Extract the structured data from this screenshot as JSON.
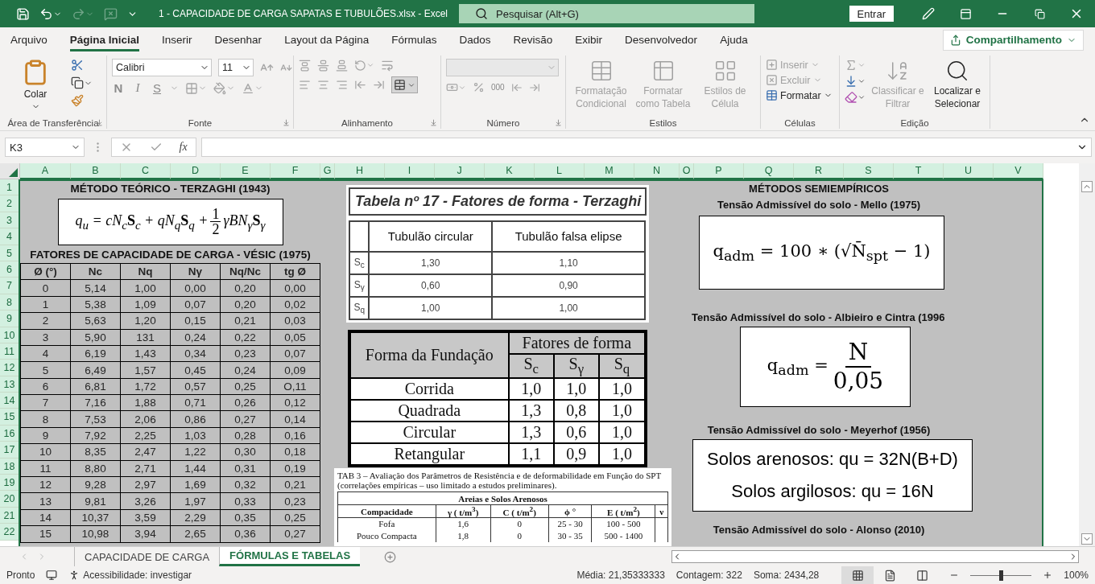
{
  "title_bar": {
    "title": "1 - CAPACIDADE DE CARGA SAPATAS E TUBULÕES.xlsx  -  Excel",
    "search": {
      "placeholder": "Pesquisar (Alt+G)"
    },
    "sign_in": "Entrar",
    "redo": {
      "disabled": true
    }
  },
  "menu": {
    "tabs": [
      {
        "label": "Arquivo",
        "selected": false
      },
      {
        "label": "Página Inicial",
        "selected": true
      },
      {
        "label": "Inserir",
        "selected": false
      },
      {
        "label": "Desenhar",
        "selected": false
      },
      {
        "label": "Layout da Página",
        "selected": false
      },
      {
        "label": "Fórmulas",
        "selected": false
      },
      {
        "label": "Dados",
        "selected": false
      },
      {
        "label": "Revisão",
        "selected": false
      },
      {
        "label": "Exibir",
        "selected": false
      },
      {
        "label": "Desenvolvedor",
        "selected": false
      },
      {
        "label": "Ajuda",
        "selected": false
      }
    ],
    "share": "Compartilhamento"
  },
  "ribbon": {
    "clipboard": {
      "paste": "Colar",
      "label": "Área de Transferência"
    },
    "font": {
      "name": "Calibri",
      "size": "11",
      "bold": "N",
      "italic": "I",
      "underline": "S",
      "label": "Fonte"
    },
    "alignment": {
      "label": "Alinhamento"
    },
    "number": {
      "format": {
        "disabled": true
      },
      "thousands": "000",
      "label": "Número"
    },
    "styles": {
      "buttons": [
        {
          "label": "Formatação Condicional",
          "disabled": true
        },
        {
          "label": "Formatar como Tabela",
          "disabled": true
        },
        {
          "label": "Estilos de Célula",
          "disabled": true
        }
      ],
      "label": "Estilos"
    },
    "cells": {
      "buttons": [
        {
          "label": "Inserir",
          "disabled": true
        },
        {
          "label": "Excluir",
          "disabled": true
        },
        {
          "label": "Formatar",
          "disabled": false
        }
      ],
      "label": "Células"
    },
    "editing": {
      "buttons": [
        {
          "label": "Classificar e Filtrar",
          "disabled": true
        },
        {
          "label": "Localizar e Selecionar",
          "disabled": false
        }
      ],
      "label": "Edição"
    }
  },
  "formula_bar": {
    "name_box": "K3",
    "function_label": "fx"
  },
  "sheet": {
    "columns": [
      {
        "label": "A",
        "selected": true
      },
      {
        "label": "B",
        "selected": true
      },
      {
        "label": "C",
        "selected": true
      },
      {
        "label": "D",
        "selected": true
      },
      {
        "label": "E",
        "selected": true
      },
      {
        "label": "F",
        "selected": true
      },
      {
        "label": "G",
        "selected": true
      },
      {
        "label": "H",
        "selected": true
      },
      {
        "label": "I",
        "selected": true
      },
      {
        "label": "J",
        "selected": true
      },
      {
        "label": "K",
        "selected": true
      },
      {
        "label": "L",
        "selected": true
      },
      {
        "label": "M",
        "selected": true
      },
      {
        "label": "N",
        "selected": true
      },
      {
        "label": "O",
        "selected": true
      },
      {
        "label": "P",
        "selected": true
      },
      {
        "label": "Q",
        "selected": true
      },
      {
        "label": "R",
        "selected": true
      },
      {
        "label": "S",
        "selected": true
      },
      {
        "label": "T",
        "selected": true
      },
      {
        "label": "U",
        "selected": true
      },
      {
        "label": "V",
        "selected": true
      }
    ],
    "rows": [
      {
        "label": "1",
        "selected": true
      },
      {
        "label": "2",
        "selected": true
      },
      {
        "label": "3",
        "selected": true
      },
      {
        "label": "4",
        "selected": true
      },
      {
        "label": "5",
        "selected": true
      },
      {
        "label": "6",
        "selected": true
      },
      {
        "label": "7",
        "selected": true
      },
      {
        "label": "8",
        "selected": true
      },
      {
        "label": "9",
        "selected": true
      },
      {
        "label": "10",
        "selected": true
      },
      {
        "label": "11",
        "selected": true
      },
      {
        "label": "12",
        "selected": true
      },
      {
        "label": "13",
        "selected": true
      },
      {
        "label": "14",
        "selected": true
      },
      {
        "label": "15",
        "selected": true
      },
      {
        "label": "16",
        "selected": true
      },
      {
        "label": "17",
        "selected": true
      },
      {
        "label": "18",
        "selected": true
      },
      {
        "label": "19",
        "selected": true
      },
      {
        "label": "20",
        "selected": true
      },
      {
        "label": "21",
        "selected": true
      },
      {
        "label": "22",
        "selected": true
      }
    ],
    "terzaghi": {
      "title": "MÉTODO TEÓRICO - TERZAGHI (1943)",
      "formula": {
        "lhs": "q$_{u}$ = cN$_{c}$**S**$_{c}$ + qN$_{q}$**S**$_{q}$ +",
        "numerator": "1",
        "denominator": "2",
        "rhs": "γBN$_{γ}$**S**$_{γ}$"
      }
    },
    "vesic": {
      "title": "FATORES DE CAPACIDADE DE CARGA - VÉSIC (1975)",
      "columns": [
        "Ø (°)",
        "Nc",
        "Nq",
        "Nγ",
        "Nq/Nc",
        "tg Ø"
      ],
      "rows": [
        [
          "0",
          "5,14",
          "1,00",
          "0,00",
          "0,20",
          "0,00"
        ],
        [
          "1",
          "5,38",
          "1,09",
          "0,07",
          "0,20",
          "0,02"
        ],
        [
          "2",
          "5,63",
          "1,20",
          "0,15",
          "0,21",
          "0,03"
        ],
        [
          "3",
          "5,90",
          "131",
          "0,24",
          "0,22",
          "0,05"
        ],
        [
          "4",
          "6,19",
          "1,43",
          "0,34",
          "0,23",
          "0,07"
        ],
        [
          "5",
          "6,49",
          "1,57",
          "0,45",
          "0,24",
          "0,09"
        ],
        [
          "6",
          "6,81",
          "1,72",
          "0,57",
          "0,25",
          "O,11"
        ],
        [
          "7",
          "7,16",
          "1,88",
          "0,71",
          "0,26",
          "0,12"
        ],
        [
          "8",
          "7,53",
          "2,06",
          "0,86",
          "0,27",
          "0,14"
        ],
        [
          "9",
          "7,92",
          "2,25",
          "1,03",
          "0,28",
          "0,16"
        ],
        [
          "10",
          "8,35",
          "2,47",
          "1,22",
          "0,30",
          "0,18"
        ],
        [
          "11",
          "8,80",
          "2,71",
          "1,44",
          "0,31",
          "0,19"
        ],
        [
          "12",
          "9,28",
          "2,97",
          "1,69",
          "0,32",
          "0,21"
        ],
        [
          "13",
          "9,81",
          "3,26",
          "1,97",
          "0,33",
          "0,23"
        ],
        [
          "14",
          "10,37",
          "3,59",
          "2,29",
          "0,35",
          "0,25"
        ],
        [
          "15",
          "10,98",
          "3,94",
          "2,65",
          "0,36",
          "0,27"
        ]
      ]
    },
    "tabela17": {
      "title": "Tabela nº 17 - Fatores de forma - Terzaghi",
      "columns": [
        "",
        "Tubulão circular",
        "Tubulão falsa elipse"
      ],
      "rows": [
        [
          "S$_{c}$",
          "1,30",
          "1,10"
        ],
        [
          "S$_{γ}$",
          "0,60",
          "0,90"
        ],
        [
          "S$_{q}$",
          "1,00",
          "1,00"
        ]
      ]
    },
    "shape_factors": {
      "group": "Fatores de forma",
      "columns": [
        "Forma da Fundação",
        "S$_{c}$",
        "S$_{γ}$",
        "S$_{q}$"
      ],
      "rows": [
        [
          "Corrida",
          "1,0",
          "1,0",
          "1,0"
        ],
        [
          "Quadrada",
          "1,3",
          "0,8",
          "1,0"
        ],
        [
          "Circular",
          "1,3",
          "0,6",
          "1,0"
        ],
        [
          "Retangular",
          "1,1",
          "0,9",
          "1,0"
        ]
      ]
    },
    "tab3": {
      "caption": "TAB 3 – Avaliação dos Parâmetros de Resistência e de deformabilidade em Função do SPT (correlações empíricas – uso limitado a estudos preliminares).",
      "group": "Areias e Solos Arenosos",
      "columns": [
        "Compacidade",
        "γ ( t/m$^{3}$)",
        "C ( t/m$^{2}$)",
        "ϕ °",
        "E ( t/m$^{2}$)",
        "ν"
      ],
      "rows": [
        [
          "Fofa",
          "1,6",
          "0",
          "25 - 30",
          "100 - 500"
        ],
        [
          "Pouco Compacta",
          "1,8",
          "0",
          "30 - 35",
          "500 - 1400"
        ]
      ]
    },
    "semiempirical": {
      "title": "MÉTODOS SEMIEMPÍRICOS",
      "mello": {
        "heading": "Tensão Admissível do solo - Mello (1975)",
        "formula": "q$_{adm}$ = 100 ∗ (√N̄$_{spt}$ − 1)"
      },
      "albieiro": {
        "heading": "Tensão Admissível do solo - Albieiro e Cintra (1996",
        "lhs": "q$_{adm}$ =",
        "numerator": "N",
        "denominator": "0,05"
      },
      "meyerhof": {
        "heading": "Tensão Admissível do solo - Meyerhof (1956)",
        "lines": [
          "Solos arenosos: qu = 32N(B+D)",
          "Solos argilosos: qu = 16N"
        ]
      },
      "alonso": {
        "heading": "Tensão Admissível do solo - Alonso (2010)"
      }
    }
  },
  "sheet_tabs": [
    {
      "label": "CAPACIDADE DE CARGA",
      "selected": false
    },
    {
      "label": "FÓRMULAS E TABELAS",
      "selected": true
    }
  ],
  "status_bar": {
    "mode": "Pronto",
    "accessibility": "Acessibilidade: investigar",
    "average": "Média: 21,35333333",
    "count": "Contagem: 322",
    "sum": "Soma: 2434,28",
    "views": [
      {
        "kind": "normal",
        "selected": true
      },
      {
        "kind": "page_layout",
        "selected": false
      },
      {
        "kind": "page_break",
        "selected": false
      }
    ],
    "zoom": {
      "level": 0.5,
      "reading": "100%"
    }
  }
}
